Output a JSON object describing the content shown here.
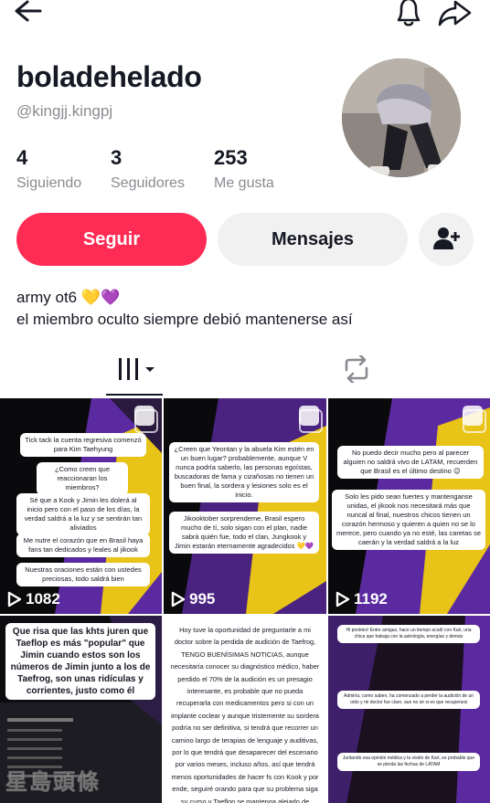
{
  "profile": {
    "username": "boladehelado",
    "handle": "@kingjj.kingpj"
  },
  "stats": [
    {
      "value": "4",
      "label": "Siguiendo"
    },
    {
      "value": "3",
      "label": "Seguidores"
    },
    {
      "value": "253",
      "label": "Me gusta"
    }
  ],
  "actions": {
    "follow_label": "Seguir",
    "message_label": "Mensajes"
  },
  "bio": {
    "line1": "army ot6 💛💜",
    "line2": "el miembro oculto siempre debió mantenerse así"
  },
  "tabs": [
    {
      "icon": "grid-videos-icon"
    },
    {
      "icon": "repost-icon"
    }
  ],
  "colors": {
    "accent": "#fe2c55",
    "button_gray": "#f1f1f2",
    "text_secondary": "#8a8b91",
    "tile_purple": "#5b2aa0",
    "tile_yellow": "#e8c318"
  },
  "videos": [
    {
      "views": "1082",
      "cards": [
        "Tick tack la cuenta regresiva comenzó para Kim Taehyung",
        "¿Como creen que reaccionaran los miembros?",
        "Sé que a Kook y Jimin les dolerá al inicio pero con el paso de los días, la verdad saldrá a la luz y se sentirán tan aliviados",
        "Me nutre el corazón que en Brasil haya fans tan dedicados y leales al jikook",
        "Nuestras oraciones están con ustedes preciosas, todo saldrá bien"
      ]
    },
    {
      "views": "995",
      "cards": [
        "¿Creen que Yeontan y la abuela Kim estén en un buen lugar? probablemente, aunque V nunca podría saberlo, las personas egoístas, buscadoras de fama y cizañosas no tienen un buen final, la sordera y lesiones solo es el inicio.",
        "Jikooktober sorprendeme, Brasil espero mucho de tí, solo sigan con el plan, nadie sabrá quién fue, todo el clan, Jungkook y Jimin estarán eternamente agradecidos 💛💜"
      ]
    },
    {
      "views": "1192",
      "cards": [
        "No puedo decir mucho pero al parecer alguien no saldrá vivo de LATAM, recuerden que Brasil es el último destino 😉",
        "Solo les pido sean fuertes y mantenganse unidas, el jikook nos necesitará más que nuncal al final, nuestros chicos tienen un corazón hermoso y quieren a quien no se lo merece, pero cuando ya no esté, las caretas se caerán y la verdad saldrá a la luz"
      ]
    },
    {
      "views": "",
      "cards": [
        "Que risa que las khts juren que Taeflop es más \"popular\" que Jimin cuando estos son los números de Jimin junto a los de Taefrog, son unas ridículas y corrientes, justo como él"
      ]
    },
    {
      "views": "",
      "cards": [
        "Hoy tuve la oportunidad de preguntarle a mi doctor sobre la perdida de audición de Taefrog, TENGO BUENÍSIMAS NOTICIAS, aunque necesitaría conocer su diagnóstico médico, haber perdido el 70% de la audición es un presagio interesante, es probable que no pueda recuperarla con medicamentos pero si con un implante coclear y aunque tristemente su sordera podría no ser definitiva, si tendrá que recorrer un camino largo de terapias de lenguaje y auditivas, por lo que tendrá que desaparecer del escenario por varios meses, incluso años, así que tendrá menos oportunidades de hacer fs con Kook y por ende, seguiré orando para que su problema siga su curso y Taeflop se mantenga alejado de"
      ]
    },
    {
      "views": "",
      "cards": [
        "Hi pookies! Entre amigas, hace un tiempo acudí con Kari, una chica que trabaja con la astrología, energías y demás",
        "Admiría, como saben, ha comenzado a perder la audición de un oído y mi doctor fue claro, aun no sé si es que recuperará",
        "Juntando esa opinión médica y la visión de Kari, es probable que se pierda las fechas de LATAM"
      ]
    }
  ],
  "watermark": "星島頭條"
}
